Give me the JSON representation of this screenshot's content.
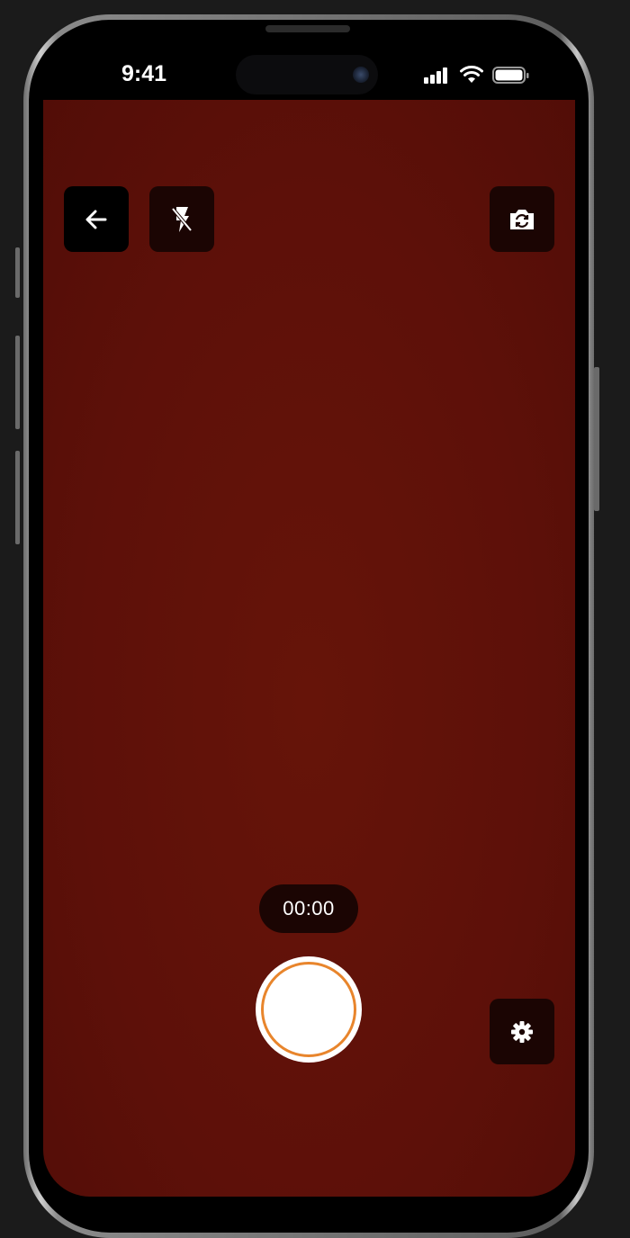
{
  "status_bar": {
    "time": "9:41",
    "icons": [
      "signal-icon",
      "wifi-icon",
      "battery-icon"
    ]
  },
  "camera": {
    "timer": "00:00",
    "controls": {
      "back": "arrow-left-icon",
      "flash": "flash-off-icon",
      "flip": "camera-flip-icon",
      "settings": "gear-icon"
    }
  },
  "colors": {
    "viewfinder": "#5d1009",
    "button_bg_dark": "#000000",
    "button_bg_tint": "#1b0503",
    "shutter_ring": "#e8852c",
    "shutter_fill": "#ffffff"
  }
}
